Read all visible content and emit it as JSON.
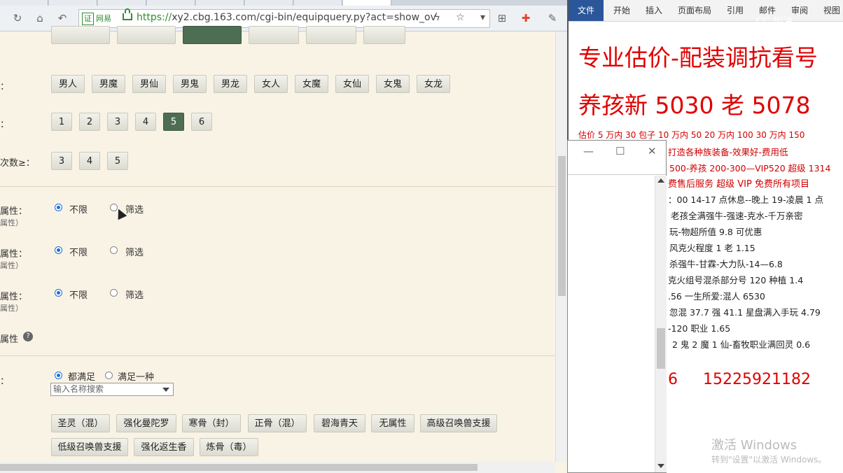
{
  "browser": {
    "cert_label": "网易",
    "url_https": "https://",
    "url_rest": "xy2.cbg.163.com/cgi-bin/equipquery.py?act=show_ov",
    "icons": [
      "refresh-icon",
      "home-icon",
      "back-icon",
      "lightning-icon",
      "star-icon",
      "dropdown-icon",
      "grid-icon",
      "game-icon",
      "wrench-icon"
    ]
  },
  "filters": {
    "row1_label": "：",
    "characters": [
      "男人",
      "男魔",
      "男仙",
      "男鬼",
      "男龙",
      "女人",
      "女魔",
      "女仙",
      "女鬼",
      "女龙"
    ],
    "row2_label": "：",
    "levels": [
      "1",
      "2",
      "3",
      "4",
      "5",
      "6"
    ],
    "levels_selected": "5",
    "row3_label": "次数≥：",
    "counts": [
      "3",
      "4",
      "5"
    ],
    "attr_rows": [
      {
        "label": "属性：",
        "sub": "属性）",
        "opt1": "不限",
        "opt2": "筛选"
      },
      {
        "label": "属性：",
        "sub": "属性）",
        "opt1": "不限",
        "opt2": "筛选"
      },
      {
        "label": "属性：",
        "sub": "属性）",
        "opt1": "不限",
        "opt2": "筛选"
      }
    ],
    "attr_help_label": "属性",
    "help_icon": "?",
    "match_label": "：",
    "match_all": "都满足",
    "match_one": "满足一种",
    "search_placeholder": "输入名称搜索",
    "skills_row1": [
      "圣灵（混）",
      "强化曼陀罗",
      "寒骨（封）",
      "正骨（混）",
      "碧海青天",
      "无属性",
      "高级召唤兽支援"
    ],
    "skills_row2": [
      "低级召唤兽支援",
      "强化返生香",
      "炼骨（毒）"
    ]
  },
  "word": {
    "file_tab": "文件",
    "tabs": [
      "开始",
      "插入",
      "页面布局",
      "引用",
      "邮件",
      "审阅",
      "视图"
    ],
    "recording": "CC 加油",
    "headline1": "专业估价-配装调抗看号",
    "headline2": "养孩新 5030 老 5078",
    "red_lines": [
      "估价 5 万内 30 包子  10 万内 50  20 万内 100  30 万内 150",
      "打造各种族装备-效果好-费用低",
      "500-养孩 200-300—VIP520 超级 1314",
      "费售后服务    超级 VIP 免费所有项目"
    ],
    "dark_lines": [
      "：00  14-17 点休息--晚上 19-凌晨 1 点",
      "老孩全满强牛-强速-克水-千万亲密",
      "玩-物超所值 9.8 可优惠",
      "风克火程度 1 老 1.15",
      "杀强牛-甘霖-大力队-14—6.8",
      "克火组号混杀部分号 120 种植 1.4",
      ".56      一生所爱:混人 6530",
      "忽混 37.7 强 41.1 星盘满入手玩 4.79",
      "-120 职业 1.65",
      "2 鬼 2 魔 1 仙-畜牧职业满回灵 0.6"
    ],
    "phone_prefix": "6",
    "phone": "15225921182",
    "watermark1": "激活 Windows",
    "watermark2": "转到\"设置\"以激活 Windows。"
  },
  "popup": {
    "controls": [
      "minimize-icon",
      "maximize-icon",
      "close-icon"
    ]
  }
}
